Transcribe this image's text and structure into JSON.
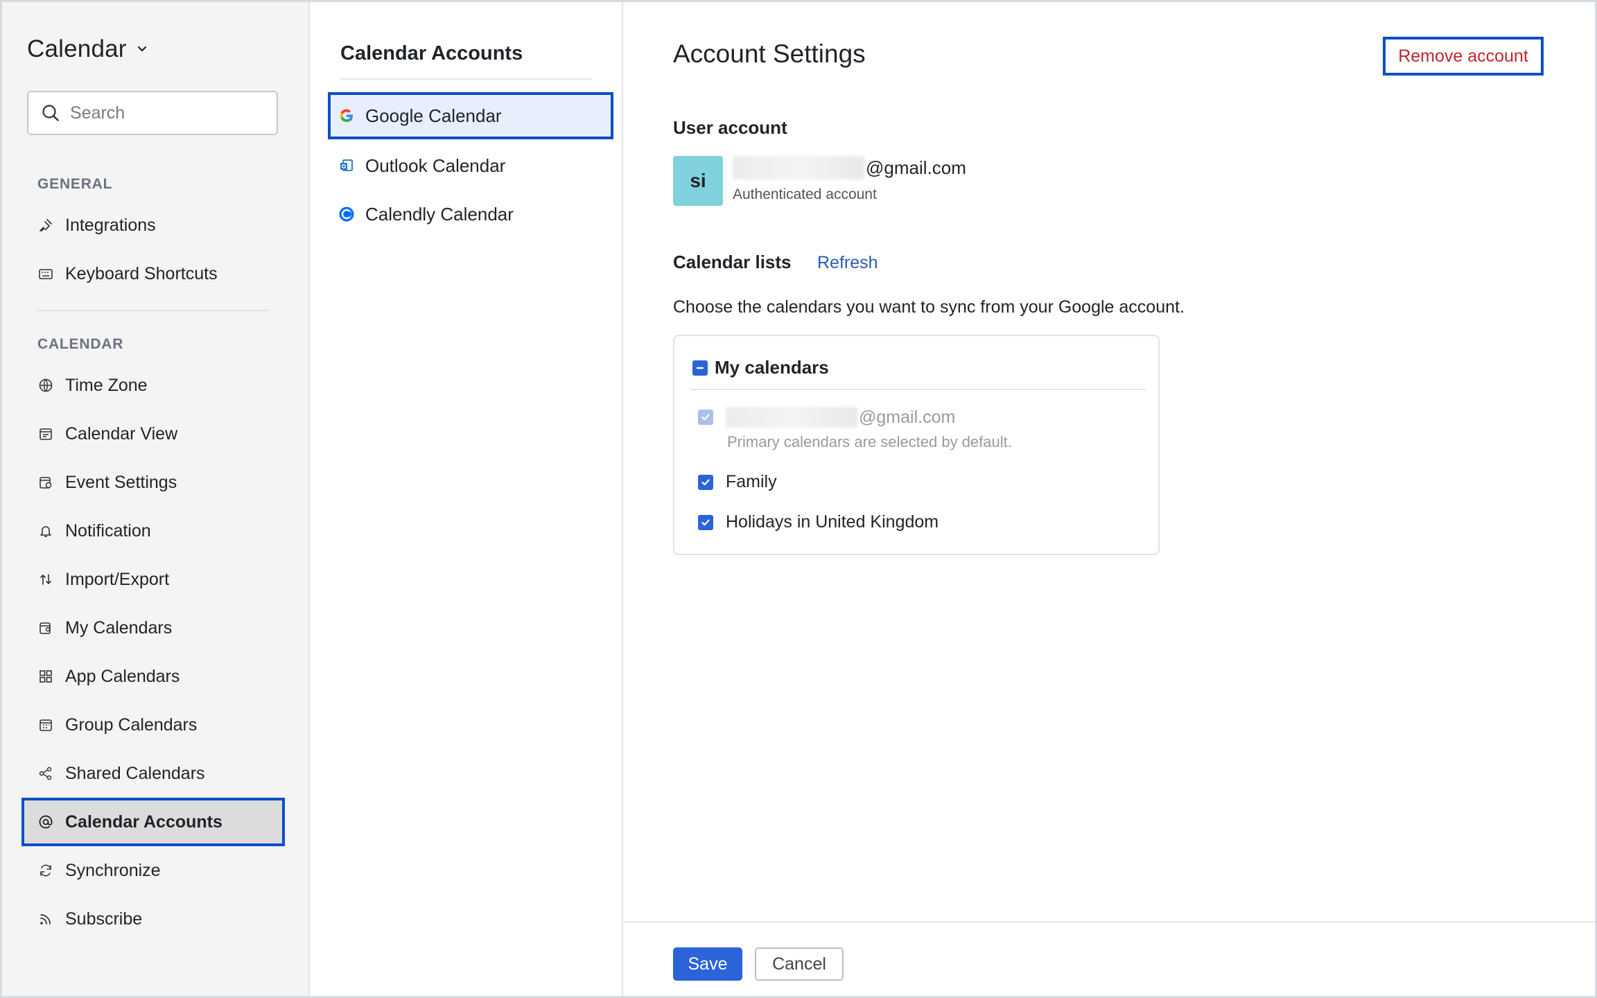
{
  "sidebar": {
    "app_title": "Calendar",
    "search_placeholder": "Search",
    "general_label": "GENERAL",
    "calendar_label": "CALENDAR",
    "general_items": [
      {
        "label": "Integrations",
        "icon": "plug-icon"
      },
      {
        "label": "Keyboard Shortcuts",
        "icon": "keyboard-icon"
      }
    ],
    "calendar_items": [
      {
        "label": "Time Zone",
        "icon": "globe-icon"
      },
      {
        "label": "Calendar View",
        "icon": "calendar-view-icon"
      },
      {
        "label": "Event Settings",
        "icon": "event-settings-icon"
      },
      {
        "label": "Notification",
        "icon": "bell-icon"
      },
      {
        "label": "Import/Export",
        "icon": "import-export-icon"
      },
      {
        "label": "My Calendars",
        "icon": "my-calendars-icon"
      },
      {
        "label": "App Calendars",
        "icon": "app-grid-icon"
      },
      {
        "label": "Group Calendars",
        "icon": "group-calendar-icon"
      },
      {
        "label": "Shared Calendars",
        "icon": "share-icon"
      },
      {
        "label": "Calendar Accounts",
        "icon": "at-sign-icon",
        "active": true
      },
      {
        "label": "Synchronize",
        "icon": "sync-icon"
      },
      {
        "label": "Subscribe",
        "icon": "rss-icon"
      }
    ]
  },
  "accounts": {
    "title": "Calendar Accounts",
    "items": [
      {
        "label": "Google Calendar",
        "icon": "google-icon",
        "active": true
      },
      {
        "label": "Outlook Calendar",
        "icon": "outlook-icon"
      },
      {
        "label": "Calendly Calendar",
        "icon": "calendly-icon"
      }
    ]
  },
  "main": {
    "title": "Account Settings",
    "remove_label": "Remove account",
    "user_account_label": "User account",
    "avatar_initials": "si",
    "email_suffix": "@gmail.com",
    "auth_note": "Authenticated account",
    "calendar_lists_label": "Calendar lists",
    "refresh_label": "Refresh",
    "choose_text": "Choose the calendars you want to sync from your Google account.",
    "my_calendars_label": "My calendars",
    "calendars": [
      {
        "label": "@gmail.com",
        "checked": true,
        "disabled": true
      },
      {
        "label": "Family",
        "checked": true,
        "disabled": false
      },
      {
        "label": "Holidays in United Kingdom",
        "checked": true,
        "disabled": false
      }
    ],
    "primary_note": "Primary calendars are selected by default.",
    "save_label": "Save",
    "cancel_label": "Cancel"
  },
  "colors": {
    "accent": "#2b63d9",
    "focus_outline": "#0b4fc4",
    "danger": "#c0262d",
    "avatar_bg": "#7fd1dd"
  }
}
